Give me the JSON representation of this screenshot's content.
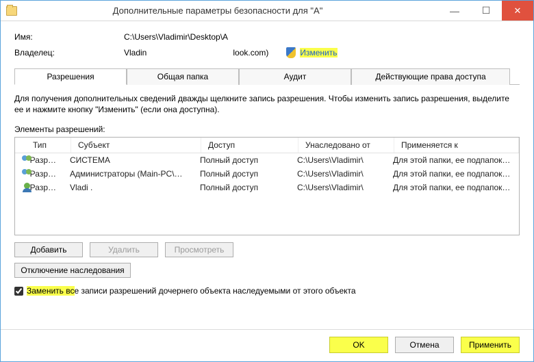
{
  "window": {
    "title": "Дополнительные параметры безопасности  для \"A\""
  },
  "fields": {
    "name_label": "Имя:",
    "name_value": "C:\\Users\\Vladimir\\Desktop\\A",
    "owner_label": "Владелец:",
    "owner_value": "Vladin",
    "owner_account_suffix": "look.com)",
    "change_link": "Изменить"
  },
  "tabs": {
    "permissions": "Разрешения",
    "shared": "Общая папка",
    "audit": "Аудит",
    "effective": "Действующие права доступа"
  },
  "instructions": "Для получения дополнительных сведений дважды щелкните запись разрешения. Чтобы изменить запись разрешения, выделите ее и нажмите кнопку \"Изменить\" (если она доступна).",
  "list_label": "Элементы разрешений:",
  "columns": {
    "type": "Тип",
    "subject": "Субъект",
    "access": "Доступ",
    "inherited": "Унаследовано от",
    "applies": "Применяется к"
  },
  "entries": [
    {
      "icon": "two",
      "type": "Разр…",
      "subject": "СИСТЕМА",
      "access": "Полный доступ",
      "inherited": "C:\\Users\\Vladimir\\",
      "applies": "Для этой папки, ее подпапок …"
    },
    {
      "icon": "two",
      "type": "Разр…",
      "subject": "Администраторы (Main-PC\\…",
      "access": "Полный доступ",
      "inherited": "C:\\Users\\Vladimir\\",
      "applies": "Для этой папки, ее подпапок …"
    },
    {
      "icon": "one",
      "type": "Разр…",
      "subject": "Vladi                                     .",
      "access": "Полный доступ",
      "inherited": "C:\\Users\\Vladimir\\",
      "applies": "Для этой папки, ее подпапок …"
    }
  ],
  "buttons": {
    "add": "Добавить",
    "remove": "Удалить",
    "view": "Просмотреть",
    "disable_inherit": "Отключение наследования"
  },
  "checkbox": {
    "replace": "Заменить все записи разрешений дочернего объекта наследуемыми от этого объекта",
    "hl_part": "Заменить вс"
  },
  "footer": {
    "ok": "OK",
    "cancel": "Отмена",
    "apply": "Применить"
  }
}
